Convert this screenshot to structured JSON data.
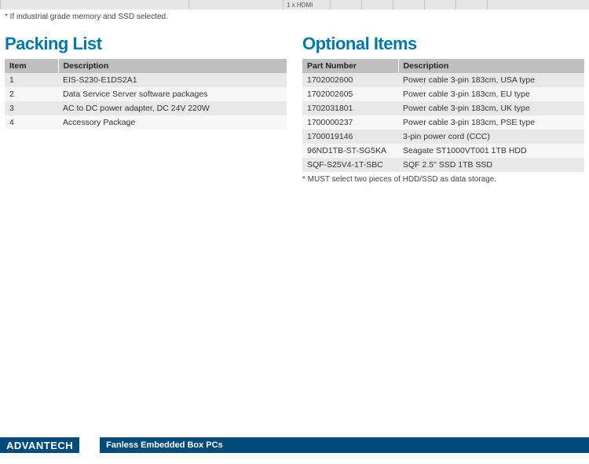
{
  "top_fragment_text": "1 x HDMI",
  "top_note": "* If industrial grade memory and SSD selected.",
  "packing_list": {
    "heading": "Packing List",
    "headers": [
      "Item",
      "Description"
    ],
    "rows": [
      {
        "item": "1",
        "description": "EIS-S230-E1DS2A1"
      },
      {
        "item": "2",
        "description": "Data Service Server software packages"
      },
      {
        "item": "3",
        "description": "AC to DC power adapter, DC 24V 220W"
      },
      {
        "item": "4",
        "description": "Accessory Package"
      }
    ]
  },
  "optional_items": {
    "heading": "Optional Items",
    "headers": [
      "Part Number",
      "Description"
    ],
    "rows": [
      {
        "part": "1702002600",
        "description": "Power cable 3-pin 183cm, USA type"
      },
      {
        "part": "1702002605",
        "description": "Power cable 3-pin 183cm, EU type"
      },
      {
        "part": "1702031801",
        "description": "Power cable 3-pin 183cm, UK type"
      },
      {
        "part": "1700000237",
        "description": "Power cable 3-pin 183cm, PSE type"
      },
      {
        "part": "1700019146",
        "description": "3-pin power cord (CCC)"
      },
      {
        "part": "96ND1TB-ST-SG5KA",
        "description": "Seagate ST1000VT001 1TB HDD"
      },
      {
        "part": "SQF-S25V4-1T-SBC",
        "description": "SQF 2.5\" SSD 1TB SSD"
      }
    ],
    "footnote": "* MUST select two pieces of HDD/SSD as data storage."
  },
  "footer": {
    "brand": "ADVANTECH",
    "category": "Fanless Embedded Box PCs"
  }
}
